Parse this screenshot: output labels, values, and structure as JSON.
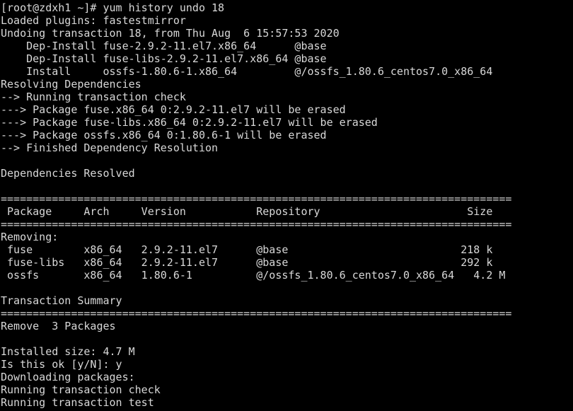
{
  "terminal": {
    "prompt": "[root@zdxh1 ~]# ",
    "command": "yum history undo 18",
    "lines": [
      "Loaded plugins: fastestmirror",
      "Undoing transaction 18, from Thu Aug  6 15:57:53 2020",
      "    Dep-Install fuse-2.9.2-11.el7.x86_64      @base",
      "    Dep-Install fuse-libs-2.9.2-11.el7.x86_64 @base",
      "    Install     ossfs-1.80.6-1.x86_64         @/ossfs_1.80.6_centos7.0_x86_64",
      "Resolving Dependencies",
      "--> Running transaction check",
      "---> Package fuse.x86_64 0:2.9.2-11.el7 will be erased",
      "---> Package fuse-libs.x86_64 0:2.9.2-11.el7 will be erased",
      "---> Package ossfs.x86_64 0:1.80.6-1 will be erased",
      "--> Finished Dependency Resolution",
      "",
      "Dependencies Resolved",
      "",
      "================================================================================",
      " Package     Arch     Version           Repository                       Size",
      "================================================================================",
      "Removing:",
      " fuse        x86_64   2.9.2-11.el7      @base                           218 k",
      " fuse-libs   x86_64   2.9.2-11.el7      @base                           292 k",
      " ossfs       x86_64   1.80.6-1          @/ossfs_1.80.6_centos7.0_x86_64   4.2 M",
      "",
      "Transaction Summary",
      "================================================================================",
      "Remove  3 Packages",
      "",
      "Installed size: 4.7 M",
      "Is this ok [y/N]: y",
      "Downloading packages:",
      "Running transaction check",
      "Running transaction test"
    ]
  }
}
